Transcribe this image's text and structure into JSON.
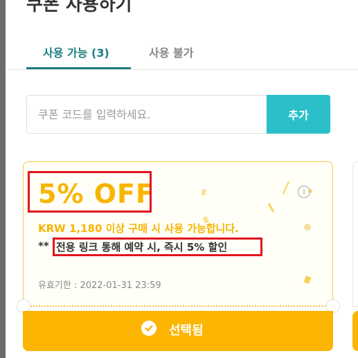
{
  "modal": {
    "title": "쿠폰 사용하기"
  },
  "tabs": [
    {
      "label": "사용 가능 (3)",
      "active": true
    },
    {
      "label": "사용 불가",
      "active": false
    }
  ],
  "coupon_code": {
    "placeholder": "쿠폰 코드를 입력하세요.",
    "value": "",
    "add_button_label": "추가"
  },
  "coupon": {
    "discount": "5% OFF",
    "min_purchase": "KRW 1,180 이상 구매 시 사용 가능합니다.",
    "benefit_prefix": "**",
    "benefit": "전용 링크 통해 예약 시, 즉시 5% 할인",
    "expiry": "유효기한 : 2022-01-31 23:59",
    "select_label": "선택됨",
    "info_icon": "info-icon",
    "check_icon": "check-icon"
  },
  "colors": {
    "accent_teal": "#1e7d80",
    "add_button": "#2bbfc9",
    "coupon_yellow": "#f7b500",
    "select_button": "#fbb502",
    "highlight_red": "#e1141e"
  }
}
